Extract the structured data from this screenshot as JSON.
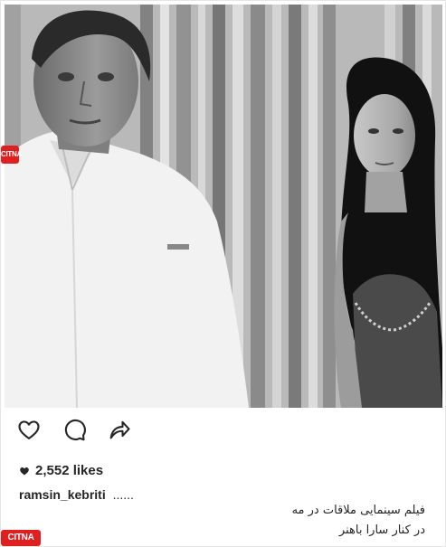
{
  "post": {
    "likes_count": "2,552 likes",
    "username": "ramsin_kebriti",
    "caption_tail": "......",
    "caption_line1": "فیلم سینمایی ملاقات در مه",
    "caption_line2": "در کنار سارا باهنر"
  },
  "watermark": {
    "brand": "CITNA"
  },
  "icons": {
    "like": "heart-outline-icon",
    "comment": "comment-bubble-icon",
    "share": "share-arrow-icon",
    "likes_marker": "heart-filled-icon"
  },
  "colors": {
    "text": "#262626",
    "watermark": "#e02020"
  }
}
